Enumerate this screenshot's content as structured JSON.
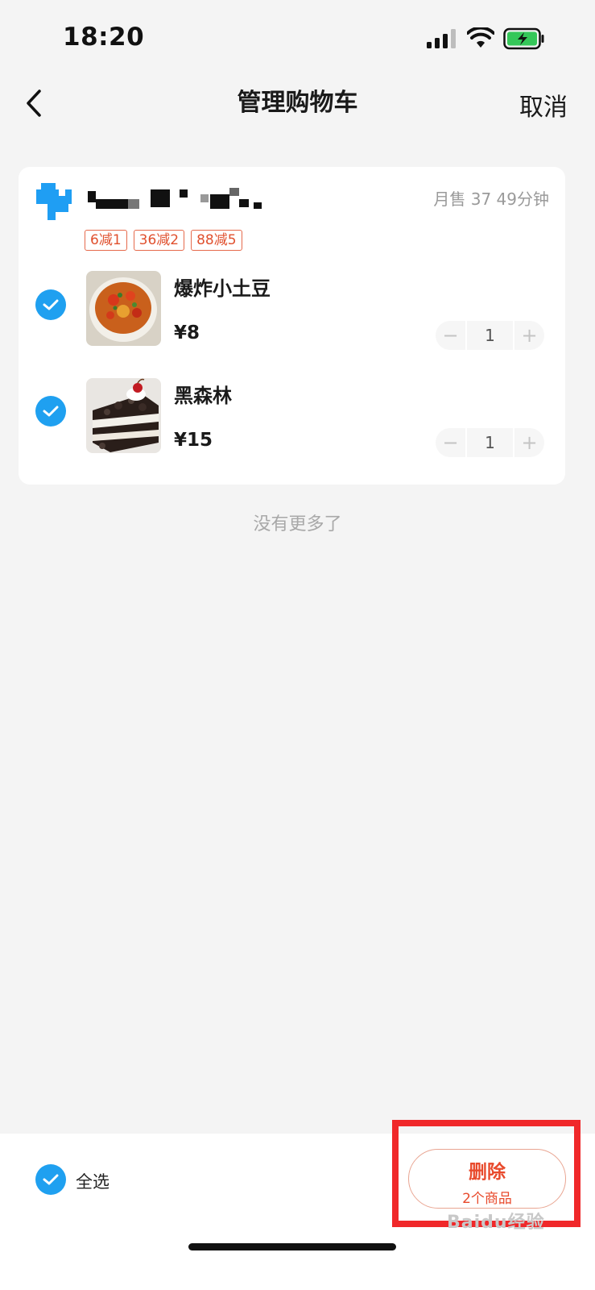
{
  "status_bar": {
    "time": "18:20",
    "signal_icon": "signal-icon",
    "wifi_icon": "wifi-icon",
    "battery_icon": "battery-charging-icon"
  },
  "nav": {
    "title": "管理购物车",
    "back_icon": "chevron-left-icon",
    "cancel_label": "取消"
  },
  "shop": {
    "meta": "月售 37 49分钟",
    "promos": [
      "6减1",
      "36减2",
      "88减5"
    ]
  },
  "items": [
    {
      "name": "爆炸小土豆",
      "price": "¥8",
      "quantity": "1",
      "checked": true
    },
    {
      "name": "黑森林",
      "price": "¥15",
      "quantity": "1",
      "checked": true
    }
  ],
  "stepper": {
    "minus": "−",
    "plus": "+"
  },
  "list_end": "没有更多了",
  "bottom_bar": {
    "select_all_label": "全选",
    "delete_label": "删除",
    "delete_sub": "2个商品",
    "watermark": "Baidu经验"
  },
  "colors": {
    "accent_blue": "#1fa0f0",
    "delete_red": "#e84a2c",
    "highlight": "#f0282a"
  }
}
